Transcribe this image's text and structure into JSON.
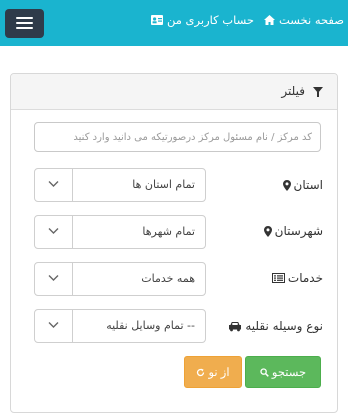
{
  "nav": {
    "home_label": "صفحه نخست",
    "account_label": "حساب کاربری من",
    "icons": [
      "home-icon",
      "id-card-icon",
      "hamburger-menu-icon"
    ],
    "bar_color": "#1ab4cf"
  },
  "filter": {
    "title": "فیلتر",
    "search_placeholder": "کد مرکز / نام مسئول مرکز درصورتیکه می دانید وارد کنید",
    "fields": [
      {
        "label": "استان",
        "value": "تمام استان ها",
        "icon": "map-marker-icon"
      },
      {
        "label": "شهرستان",
        "value": "تمام شهرها",
        "icon": "map-marker-icon"
      },
      {
        "label": "خدمات",
        "value": "همه خدمات",
        "icon": "list-icon"
      },
      {
        "label": "نوع وسیله نقلیه",
        "value": "-- تمام وسایل نقلیه",
        "icon": "car-icon"
      }
    ],
    "search_button": "جستجو",
    "reset_button": "از نو"
  }
}
